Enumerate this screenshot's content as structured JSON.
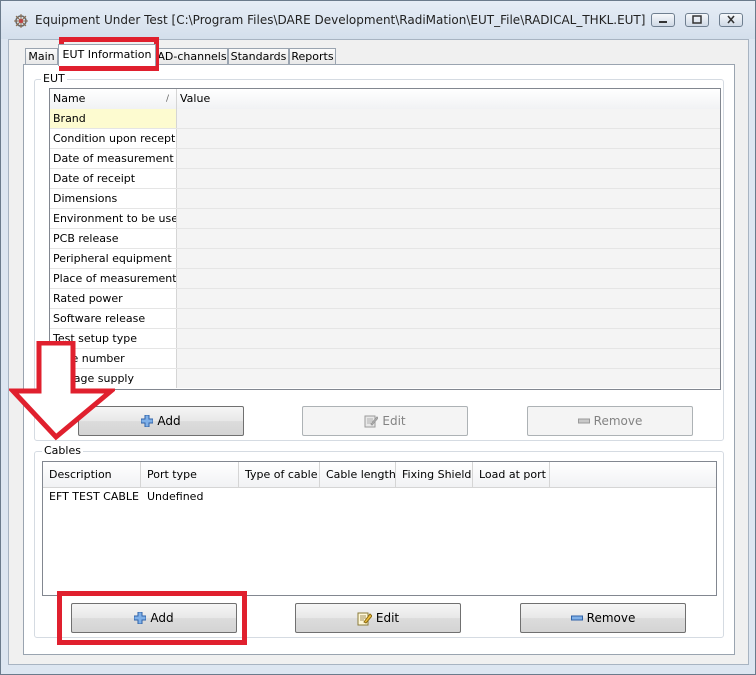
{
  "window": {
    "title": "Equipment Under Test [C:\\Program Files\\DARE Development\\RadiMation\\EUT_File\\RADICAL_THKL.EUT]",
    "icon": "app-icon",
    "controls": [
      "minimize-icon",
      "restore-icon",
      "close-icon"
    ]
  },
  "tabs": [
    {
      "label": "Main",
      "active": false
    },
    {
      "label": "EUT Information",
      "active": true
    },
    {
      "label": "AD-channels",
      "active": false
    },
    {
      "label": "Standards",
      "active": false
    },
    {
      "label": "Reports",
      "active": false
    }
  ],
  "eut_group": {
    "title": "EUT",
    "grid_headers": {
      "name": "Name",
      "value": "Value"
    },
    "rows": [
      {
        "name": "Brand",
        "value": ""
      },
      {
        "name": "Condition upon reception",
        "value": ""
      },
      {
        "name": "Date of measurement",
        "value": ""
      },
      {
        "name": "Date of receipt",
        "value": ""
      },
      {
        "name": "Dimensions",
        "value": ""
      },
      {
        "name": "Environment to be used",
        "value": ""
      },
      {
        "name": "PCB release",
        "value": ""
      },
      {
        "name": "Peripheral equipment",
        "value": ""
      },
      {
        "name": "Place of measurement",
        "value": ""
      },
      {
        "name": "Rated power",
        "value": ""
      },
      {
        "name": "Software release",
        "value": ""
      },
      {
        "name": "Test setup type",
        "value": ""
      },
      {
        "name": "Type number",
        "value": ""
      },
      {
        "name": "Voltage supply",
        "value": ""
      }
    ],
    "selected_row": "Brand",
    "buttons": {
      "add": "Add",
      "edit": "Edit",
      "remove": "Remove"
    }
  },
  "cables_group": {
    "title": "Cables",
    "columns": [
      "Description",
      "Port type",
      "Type of cable",
      "Cable length",
      "Fixing Shield",
      "Load at port"
    ],
    "rows": [
      {
        "description": "EFT TEST CABLE",
        "port_type": "Undefined",
        "type_of_cable": "",
        "cable_length": "",
        "fixing_shield": "",
        "load_at_port": ""
      }
    ],
    "buttons": {
      "add": "Add",
      "edit": "Edit",
      "remove": "Remove"
    }
  },
  "colors": {
    "highlight": "#e0202e",
    "selected_row": "#fdfbd0",
    "add_icon": "#3c78c8",
    "remove_icon": "#3c78c8"
  }
}
